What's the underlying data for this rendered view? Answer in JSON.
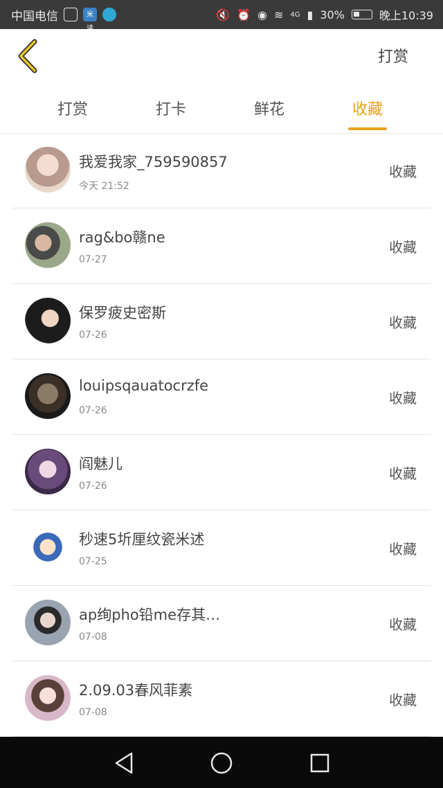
{
  "status_bar": {
    "carrier": "中国电信",
    "app_icon_1": "米读",
    "battery": "30%",
    "network": "4G",
    "time": "晚上10:39"
  },
  "header": {
    "action_label": "打赏"
  },
  "tabs": [
    {
      "label": "打赏"
    },
    {
      "label": "打卡"
    },
    {
      "label": "鲜花"
    },
    {
      "label": "收藏"
    }
  ],
  "active_tab": 3,
  "colors": {
    "accent": "#e8a21a",
    "status_bar": "#3a3a3a",
    "nav_bar": "#0a0a0a"
  },
  "rows": [
    {
      "name": "我爱我家_759590857",
      "time": "今天 21:52",
      "action": "收藏"
    },
    {
      "name": "rag&bo赣ne",
      "time": "07-27",
      "action": "收藏"
    },
    {
      "name": "保罗疲史密斯",
      "time": "07-26",
      "action": "收藏"
    },
    {
      "name": "louipsqauatocrzfe",
      "time": "07-26",
      "action": "收藏"
    },
    {
      "name": "阎魅儿",
      "time": "07-26",
      "action": "收藏"
    },
    {
      "name": "秒速5圻厘纹瓷米述",
      "time": "07-25",
      "action": "收藏"
    },
    {
      "name": "ap绚pho铅me存其…",
      "time": "07-08",
      "action": "收藏"
    },
    {
      "name": "2.09.03春风菲素",
      "time": "07-08",
      "action": "收藏"
    }
  ]
}
